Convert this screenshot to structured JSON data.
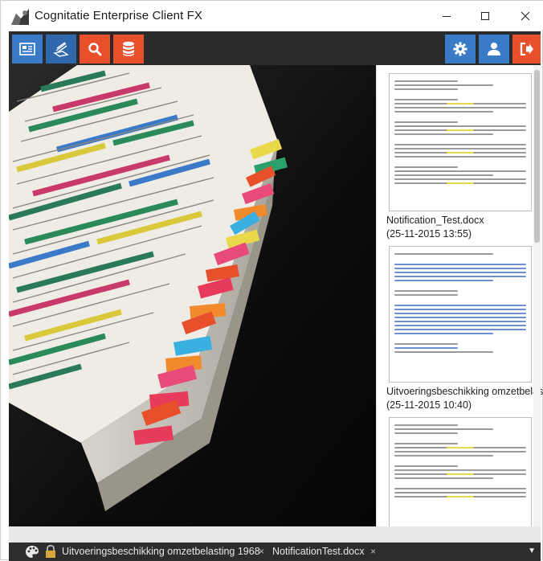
{
  "window": {
    "title": "Cognitatie Enterprise Client FX",
    "controls": {
      "minimize": "—",
      "maximize": "☐",
      "close": "✕"
    }
  },
  "toolbar": {
    "left_buttons": [
      {
        "icon": "document-list-icon",
        "color": "#3a7bc8"
      },
      {
        "icon": "stack-documents-icon",
        "color": "#2f68ad"
      },
      {
        "icon": "search-icon",
        "color": "#e8502c"
      },
      {
        "icon": "database-icon",
        "color": "#e8502c"
      }
    ],
    "right_buttons": [
      {
        "icon": "gear-icon",
        "color": "#3a7bc8"
      },
      {
        "icon": "user-icon",
        "color": "#3a7bc8"
      },
      {
        "icon": "logout-icon",
        "color": "#e8502c"
      }
    ]
  },
  "documents": [
    {
      "name": "Notification_Test.docx",
      "date": "(25-11-2015 13:55)"
    },
    {
      "name": "Uitvoeringsbeschikking omzetbelas...",
      "date": "(25-11-2015 10:40)"
    },
    {
      "name": "",
      "date": ""
    }
  ],
  "tabs": [
    {
      "label": "Uitvoeringsbeschikking omzetbelasting 1968",
      "close": "×"
    },
    {
      "label": "NotificationTest.docx",
      "close": "×"
    }
  ],
  "tab_dropdown": "▼",
  "colors": {
    "accent_blue": "#3a7bc8",
    "accent_red": "#e8502c",
    "toolbar_bg": "#2b2b2b",
    "tabbar_bg": "#2d2d2d"
  }
}
